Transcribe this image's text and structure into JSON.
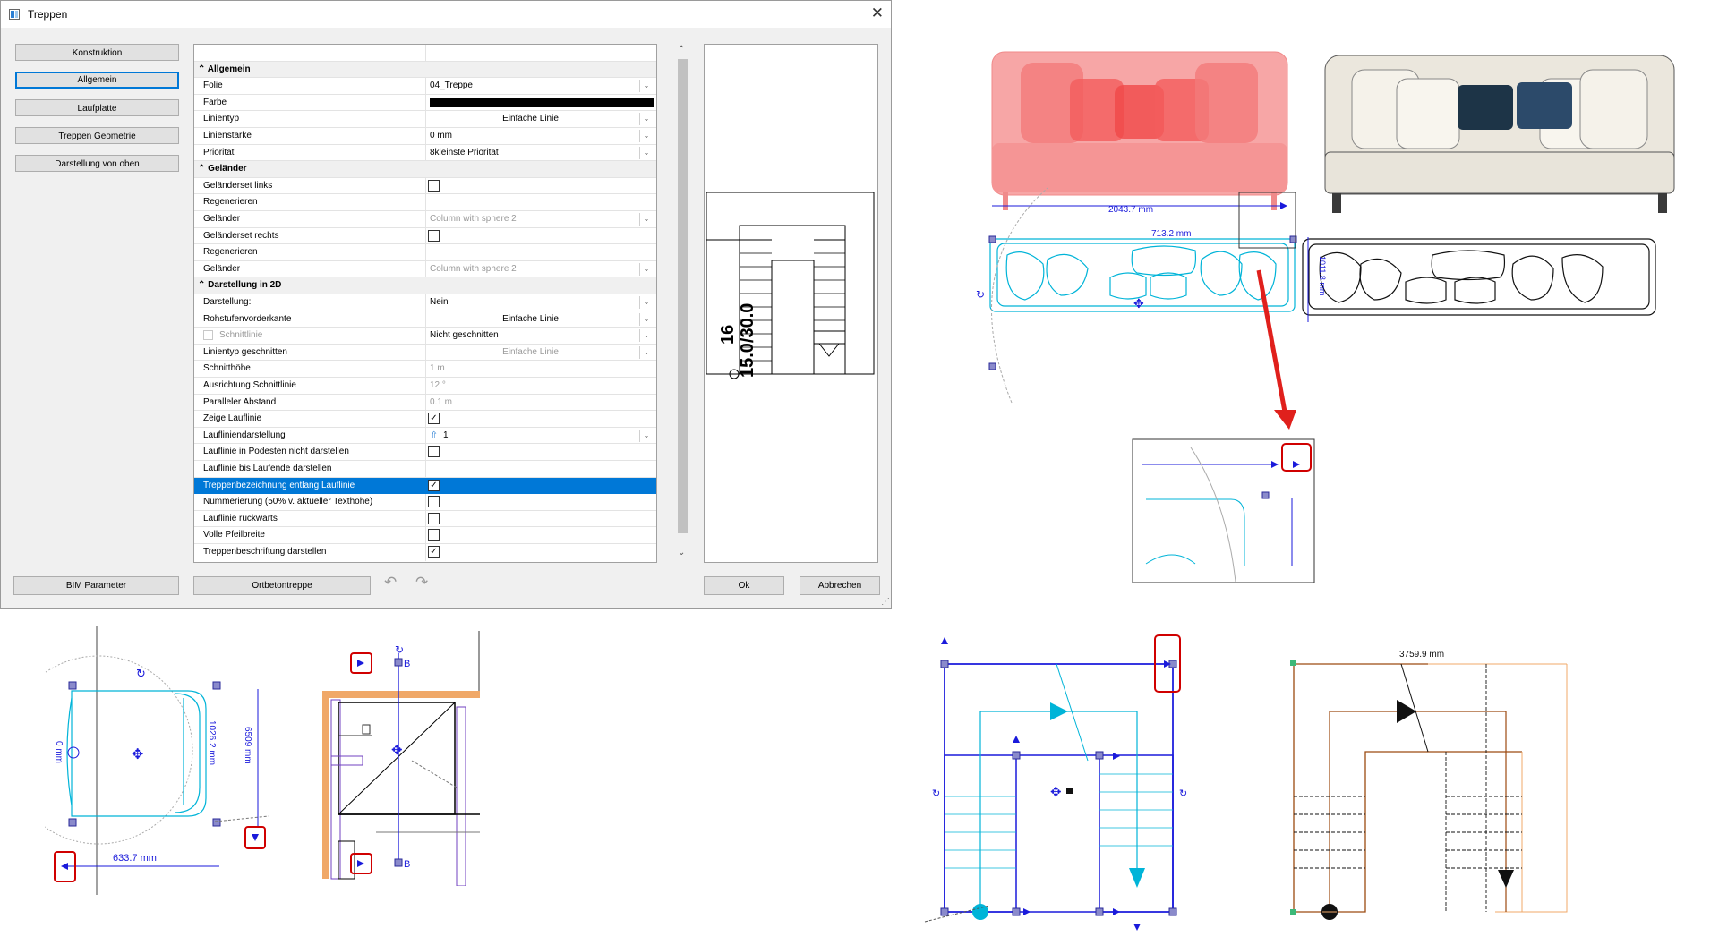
{
  "dialog": {
    "title": "Treppen",
    "close_icon": "close-icon",
    "nav_buttons": [
      "Konstruktion",
      "Allgemein",
      "Laufplatte",
      "Treppen Geometrie",
      "Darstellung von oben"
    ],
    "active_nav": "Allgemein",
    "bottom": {
      "bim_label": "BIM Parameter",
      "ortbeton_label": "Ortbetontreppe",
      "ok_label": "Ok",
      "cancel_label": "Abbrechen"
    },
    "preview": {
      "num1": "16",
      "num2": "15.0/30.0"
    }
  },
  "sections": {
    "allgemein": "Allgemein",
    "gelaender": "Geländer",
    "darstellung": "Darstellung in 2D"
  },
  "rows": {
    "folie": {
      "key": "Folie",
      "value": "04_Treppe"
    },
    "farbe": {
      "key": "Farbe",
      "value": "#000000"
    },
    "linientyp": {
      "key": "Linientyp",
      "value": "Einfache Linie"
    },
    "linienstaerke": {
      "key": "Linienstärke",
      "value": "0 mm"
    },
    "prioritaet": {
      "key": "Priorität",
      "value": "8kleinste Priorität"
    },
    "gel_links": {
      "key": "Geländerset links"
    },
    "regen1": {
      "key": "Regenerieren"
    },
    "gel1": {
      "key": "Geländer",
      "value": "Column with sphere 2"
    },
    "gel_rechts": {
      "key": "Geländerset rechts"
    },
    "regen2": {
      "key": "Regenerieren"
    },
    "gel2": {
      "key": "Geländer",
      "value": "Column with sphere 2"
    },
    "darstellung": {
      "key": "Darstellung:",
      "value": "Nein"
    },
    "rohstufen": {
      "key": "Rohstufenvorderkante",
      "value": "Einfache Linie"
    },
    "schnittlinie": {
      "key": "Schnittlinie",
      "value": "Nicht geschnitten"
    },
    "linientyp_geschn": {
      "key": "Linientyp geschnitten",
      "value": "Einfache Linie"
    },
    "schnitthoehe": {
      "key": "Schnitthöhe",
      "value": "1 m"
    },
    "ausrichtung": {
      "key": "Ausrichtung Schnittlinie",
      "value": "12 °"
    },
    "parallel": {
      "key": "Paralleler Abstand",
      "value": "0.1 m"
    },
    "zeige": {
      "key": "Zeige Lauflinie"
    },
    "lauflinien_darst": {
      "key": "Laufliniendarstellung",
      "value": "1"
    },
    "lauflinie_podest": {
      "key": "Lauflinie in Podesten nicht darstellen"
    },
    "lauflinie_bis": {
      "key": "Lauflinie bis Laufende darstellen"
    },
    "treppenbez": {
      "key": "Treppenbezeichnung entlang Lauflinie"
    },
    "nummerierung": {
      "key": "Nummerierung (50% v. aktueller Texthöhe)"
    },
    "rueckwaerts": {
      "key": "Lauflinie rückwärts"
    },
    "volle": {
      "key": "Volle Pfeilbreite"
    },
    "beschriftung": {
      "key": "Treppenbeschriftung darstellen"
    }
  },
  "dimensions": {
    "sofa_width": "2043.7 mm",
    "sofa_inner": "713.2 mm",
    "sofa_side": "1011.8 mm",
    "chair_width": "633.7 mm",
    "chair_depth": "1026.2 mm",
    "chair_offset": "0 mm",
    "chair_side": "6509 mm",
    "stair_top": "3759.9 mm",
    "marker_b": "B"
  },
  "colors": {
    "accent": "#0078d7",
    "cyan": "#00b4d8",
    "blue": "#1a1adb",
    "red_marker": "#d00000",
    "red_arrow": "#e0201c",
    "brown": "#9c4a10",
    "orange": "#f0a868"
  }
}
